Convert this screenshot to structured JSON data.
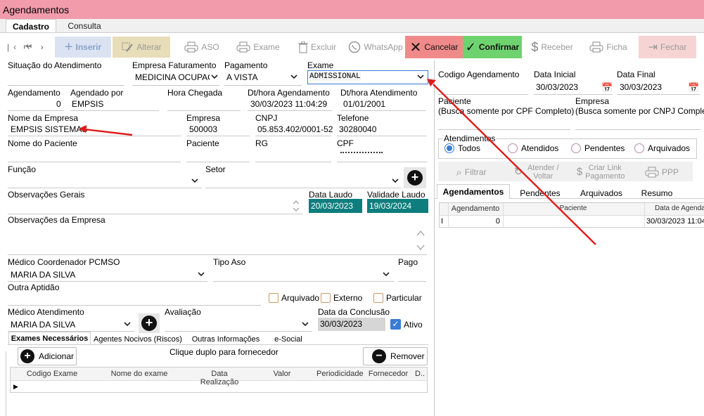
{
  "window": {
    "title": "Agendamentos"
  },
  "tabs": [
    {
      "label": "Cadastro"
    },
    {
      "label": "Consulta"
    }
  ],
  "toolbar": {
    "inserir": "Inserir",
    "alterar": "Alterar",
    "aso": "ASO",
    "exame": "Exame",
    "excluir": "Excluir",
    "whatsapp": "WhatsApp",
    "cancelar": "Cancelar",
    "confirmar": "Confirmar",
    "receber": "Receber",
    "ficha": "Ficha",
    "fechar": "Fechar",
    "colors": {
      "cancel_bg": "#f08a8a",
      "confirm_bg": "#6ed36e",
      "fechar_bg": "#f7d4d4",
      "inserir_bg": "#dbe3f3",
      "alterar_bg": "#e7ddb8"
    }
  },
  "form": {
    "situacao": {
      "label": "Situação do Atendimento",
      "value": ""
    },
    "empresa_faturamento": {
      "label": "Empresa Faturamento",
      "value": "MEDICINA OCUPACIO"
    },
    "pagamento": {
      "label": "Pagamento",
      "value": "A VISTA"
    },
    "exame": {
      "label": "Exame",
      "value": "ADMISSIONAL"
    },
    "agendamento": {
      "label": "Agendamento",
      "value": "0"
    },
    "agendado_por": {
      "label": "Agendado por",
      "value": "EMPSIS"
    },
    "hora_chegada": {
      "label": "Hora Chegada",
      "value": ""
    },
    "dt_agendamento": {
      "label": "Dt/hora Agendamento",
      "value": "30/03/2023 11:04:29"
    },
    "dt_atendimento": {
      "label": "Dt/hora Atendimento",
      "value": "01/01/2001"
    },
    "nome_empresa": {
      "label": "Nome da Empresa",
      "value": "EMPSIS SISTEMAS"
    },
    "empresa": {
      "label": "Empresa",
      "value": "500003"
    },
    "cnpj": {
      "label": "CNPJ",
      "value": "05.853.402/0001-52"
    },
    "telefone": {
      "label": "Telefone",
      "value": "30280040"
    },
    "nome_paciente": {
      "label": "Nome do Paciente",
      "value": ""
    },
    "paciente": {
      "label": "Paciente",
      "value": ""
    },
    "rg": {
      "label": "RG",
      "value": ""
    },
    "cpf": {
      "label": "CPF",
      "value": ""
    },
    "funcao": {
      "label": "Função"
    },
    "setor": {
      "label": "Setor"
    },
    "obs_gerais": {
      "label": "Observações Gerais"
    },
    "data_laudo": {
      "label": "Data Laudo",
      "value": "20/03/2023"
    },
    "validade_laudo": {
      "label": "Validade Laudo",
      "value": "19/03/2024"
    },
    "obs_empresa": {
      "label": "Observações da Empresa"
    },
    "medico_coord": {
      "label": "Médico Coordenador PCMSO",
      "value": "MARIA DA SILVA"
    },
    "tipo_aso": {
      "label": "Tipo Aso",
      "value": ""
    },
    "pago": {
      "label": "Pago"
    },
    "outra_aptidao": {
      "label": "Outra Aptidão"
    },
    "arquivado": "Arquivado",
    "externo": "Externo",
    "particular": "Particular",
    "medico_atend": {
      "label": "Médico Atendimento",
      "value": "MARIA DA SILVA"
    },
    "avaliacao": {
      "label": "Avaliação",
      "value": ""
    },
    "data_conclusao": {
      "label": "Data da Conclusão",
      "value": "30/03/2023"
    },
    "ativo": "Ativo"
  },
  "subtabs": [
    "Exames Necessários",
    "Agentes Nocivos (Riscos)",
    "Outras Informações",
    "e-Social"
  ],
  "exames": {
    "adicionar": "Adicionar",
    "hint": "Clique duplo para fornecedor",
    "remover": "Remover",
    "columns": [
      "Codigo Exame",
      "Nome do exame",
      "Data Realização",
      "Valor",
      "Periodicidade",
      "Fornecedor",
      "D.."
    ]
  },
  "right": {
    "codigo_agendamento": "Codigo Agendamento",
    "data_inicial": {
      "label": "Data Inicial",
      "value": "30/03/2023"
    },
    "data_final": {
      "label": "Data Final",
      "value": "30/03/2023"
    },
    "paciente_label": "Paciente",
    "paciente_hint": "(Busca somente por CPF Completo)",
    "empresa_label": "Empresa",
    "empresa_hint": "(Busca somente por CNPJ Completo)",
    "atendimentos": "Atendimentos",
    "radios": [
      "Todos",
      "Atendidos",
      "Pendentes",
      "Arquivados"
    ],
    "actions": {
      "filtrar": "Filtrar",
      "atender": "Atender / Voltar",
      "criar": "Criar Link Pagamento",
      "ppp": "PPP"
    },
    "tabs": [
      "Agendamentos",
      "Pendentes",
      "Arquivados",
      "Resumo"
    ],
    "grid_cols": [
      "Agendamento",
      "Paciente",
      "Data de Agendar"
    ],
    "row": {
      "marker": "I",
      "agendamento": "0",
      "paciente": "",
      "data": "30/03/2023 11:04"
    }
  }
}
